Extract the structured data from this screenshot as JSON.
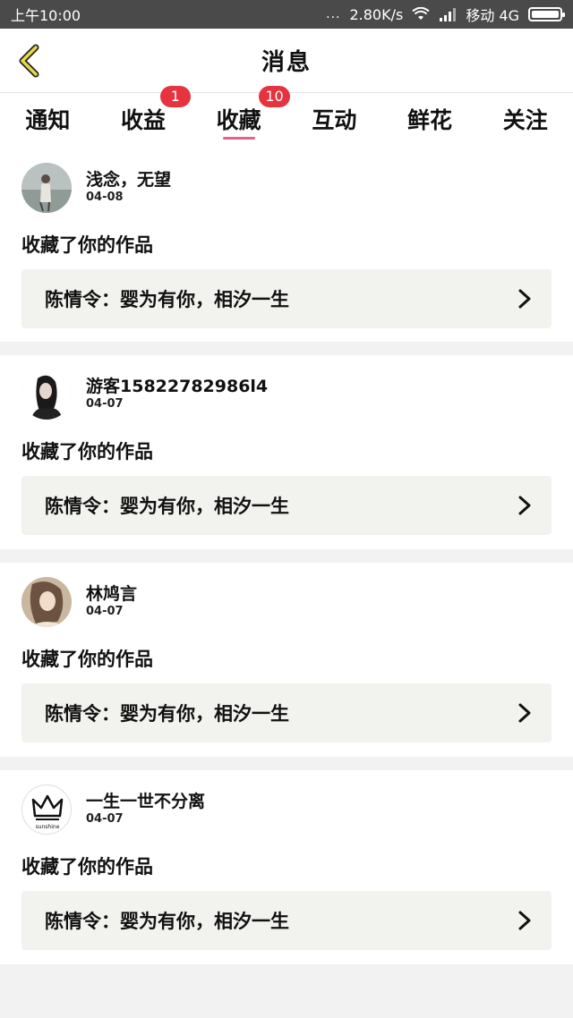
{
  "status_bar": {
    "time": "上午10:00",
    "dots": "...",
    "speed": "2.80K/s",
    "carrier": "移动 4G"
  },
  "header": {
    "title": "消息"
  },
  "tabs": [
    {
      "label": "通知",
      "badge": ""
    },
    {
      "label": "收益",
      "badge": "1"
    },
    {
      "label": "收藏",
      "badge": "10",
      "active": true
    },
    {
      "label": "互动",
      "badge": ""
    },
    {
      "label": "鲜花",
      "badge": ""
    },
    {
      "label": "关注",
      "badge": ""
    }
  ],
  "items": [
    {
      "username": "浅念，无望",
      "date": "04-08",
      "action": "收藏了你的作品",
      "work_title": "陈情令：婴为有你，相汐一生"
    },
    {
      "username": "游客15822782986l4",
      "date": "04-07",
      "action": "收藏了你的作品",
      "work_title": "陈情令：婴为有你，相汐一生"
    },
    {
      "username": "林鸠言",
      "date": "04-07",
      "action": "收藏了你的作品",
      "work_title": "陈情令：婴为有你，相汐一生"
    },
    {
      "username": "一生一世不分离",
      "date": "04-07",
      "action": "收藏了你的作品",
      "work_title": "陈情令：婴为有你，相汐一生",
      "avatar_text": "sunshine"
    }
  ],
  "colors": {
    "accent": "#e5608a",
    "badge": "#e5333f",
    "back_arrow": "#e8d84a"
  }
}
